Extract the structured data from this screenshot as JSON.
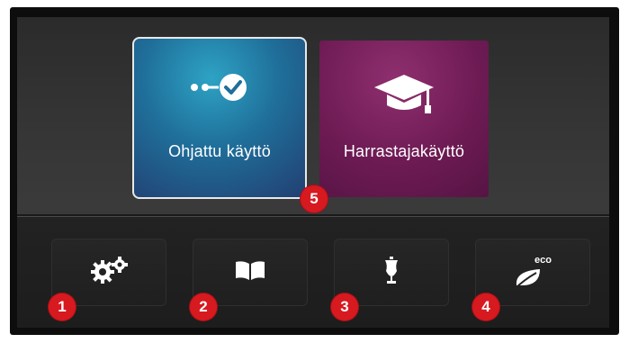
{
  "tiles": [
    {
      "label": "Ohjattu käyttö",
      "icon": "guided-steps-icon"
    },
    {
      "label": "Harrastajakäyttö",
      "icon": "graduation-cap-icon"
    }
  ],
  "bottom_buttons": [
    {
      "icon": "settings-gears-icon"
    },
    {
      "icon": "book-icon"
    },
    {
      "icon": "dress-form-icon"
    },
    {
      "icon": "eco-leaf-icon",
      "icon_text": "eco"
    }
  ],
  "badges": [
    "1",
    "2",
    "3",
    "4",
    "5"
  ],
  "colors": {
    "guided_tile": "#1f6f9a",
    "hobby_tile": "#6e1b54",
    "badge": "#d71920"
  }
}
